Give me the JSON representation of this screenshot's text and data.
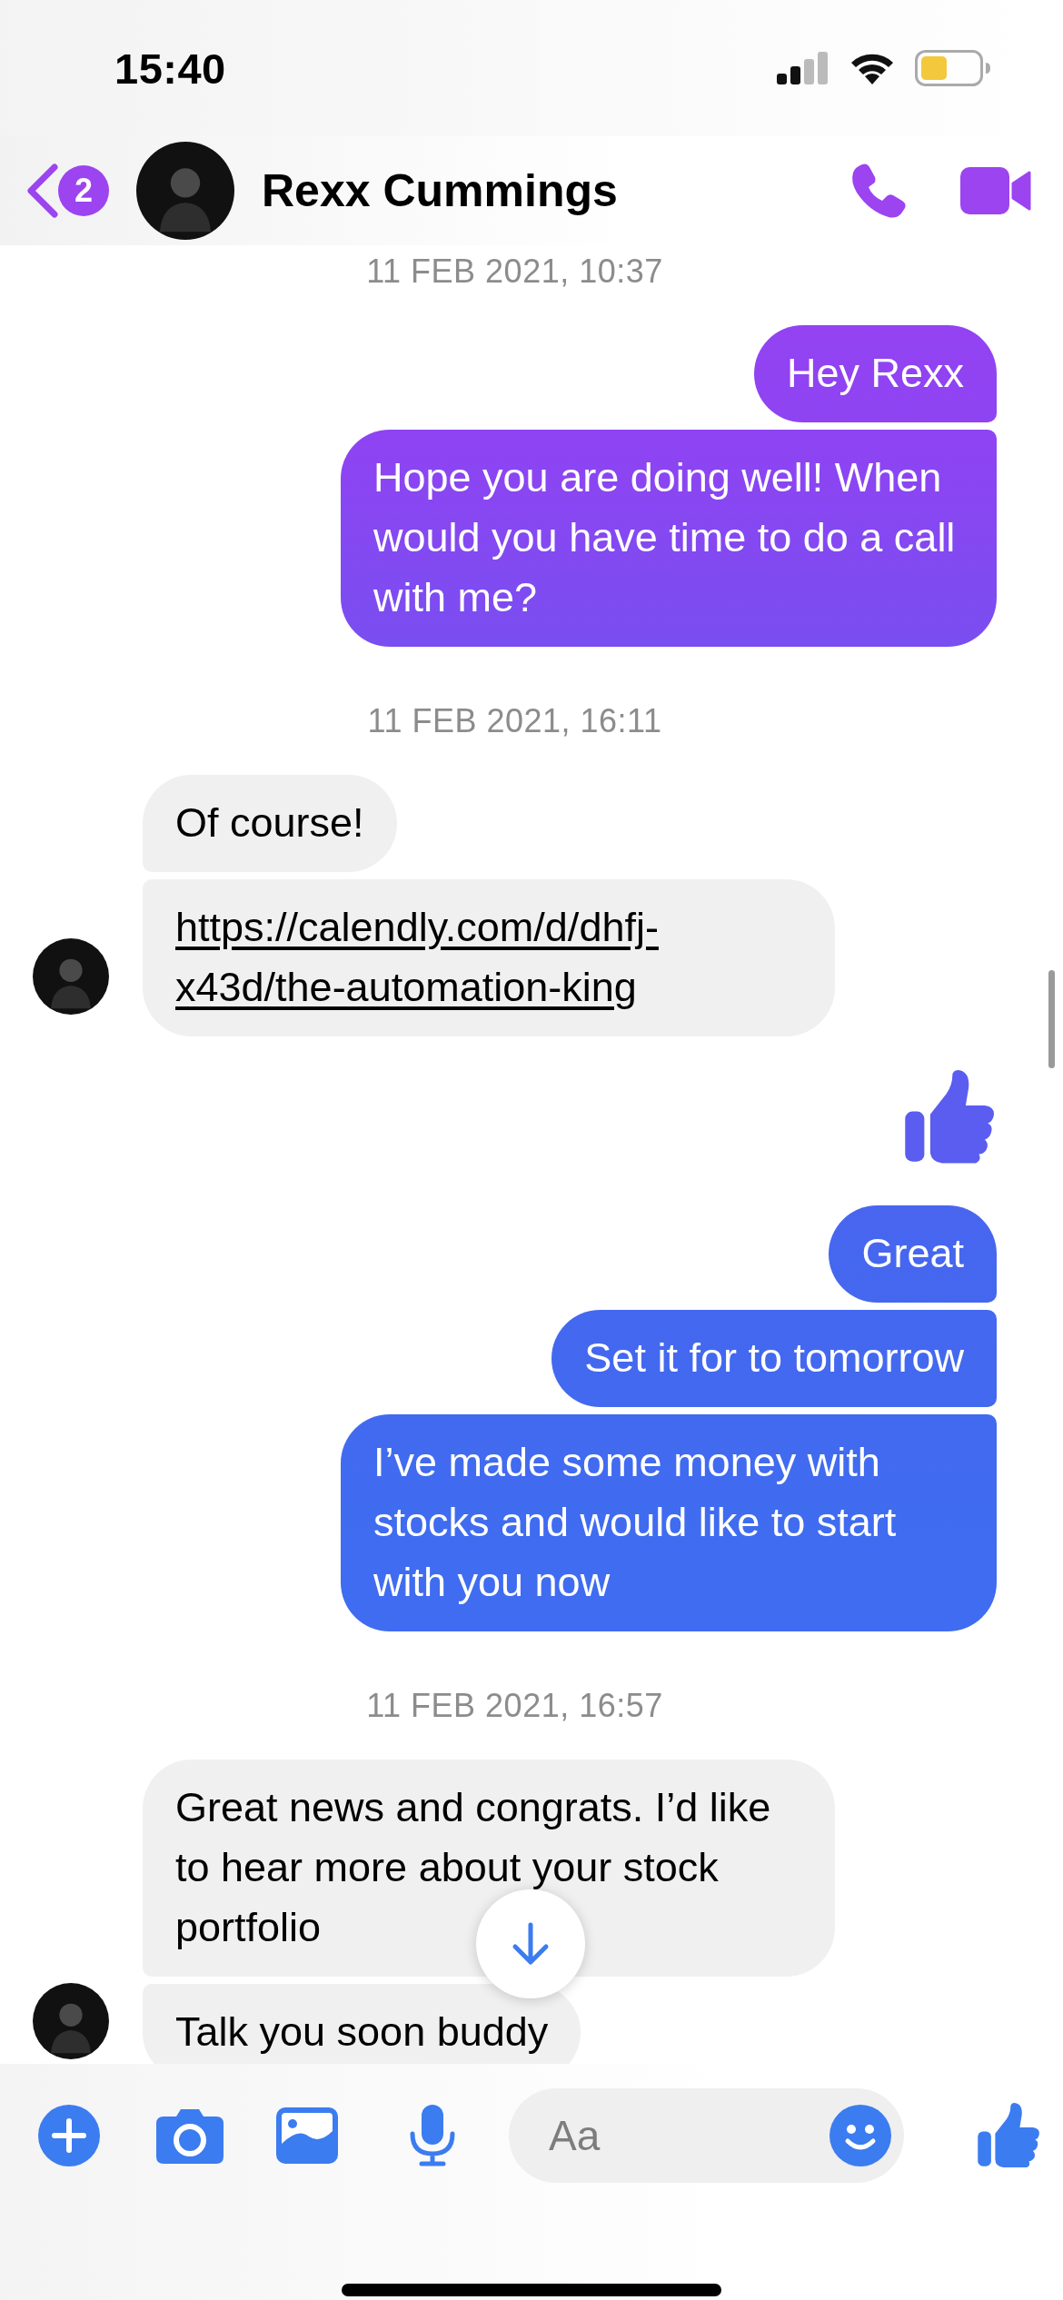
{
  "status_bar": {
    "time": "15:40"
  },
  "header": {
    "unread_badge": "2",
    "name": "Rexx Cummings"
  },
  "conversation": [
    {
      "kind": "timestamp",
      "text": "11 FEB 2021, 10:37"
    },
    {
      "kind": "sent_group",
      "messages": [
        {
          "kind": "text",
          "text": "Hey Rexx"
        },
        {
          "kind": "text",
          "text": "Hope you are doing well! When would you have time to do a call with me?"
        }
      ]
    },
    {
      "kind": "timestamp",
      "text": "11 FEB 2021, 16:11"
    },
    {
      "kind": "received_group",
      "messages": [
        {
          "kind": "text",
          "text": "Of course!"
        },
        {
          "kind": "link",
          "text": "https://calendly.com/d/dhfj-x43d/the-automation-king"
        }
      ]
    },
    {
      "kind": "sent_group",
      "messages": [
        {
          "kind": "like"
        },
        {
          "kind": "text",
          "text": "Great"
        },
        {
          "kind": "text",
          "text": "Set it for to tomorrow"
        },
        {
          "kind": "text",
          "text": "I’ve made some money with stocks and would like to start with you now"
        }
      ]
    },
    {
      "kind": "timestamp",
      "text": "11 FEB 2021, 16:57"
    },
    {
      "kind": "received_group",
      "messages": [
        {
          "kind": "text",
          "text": "Great news and congrats. I’d like to hear more about your stock portfolio"
        },
        {
          "kind": "text",
          "text": "Talk you soon buddy"
        }
      ]
    }
  ],
  "composer": {
    "placeholder": "Aa"
  }
}
